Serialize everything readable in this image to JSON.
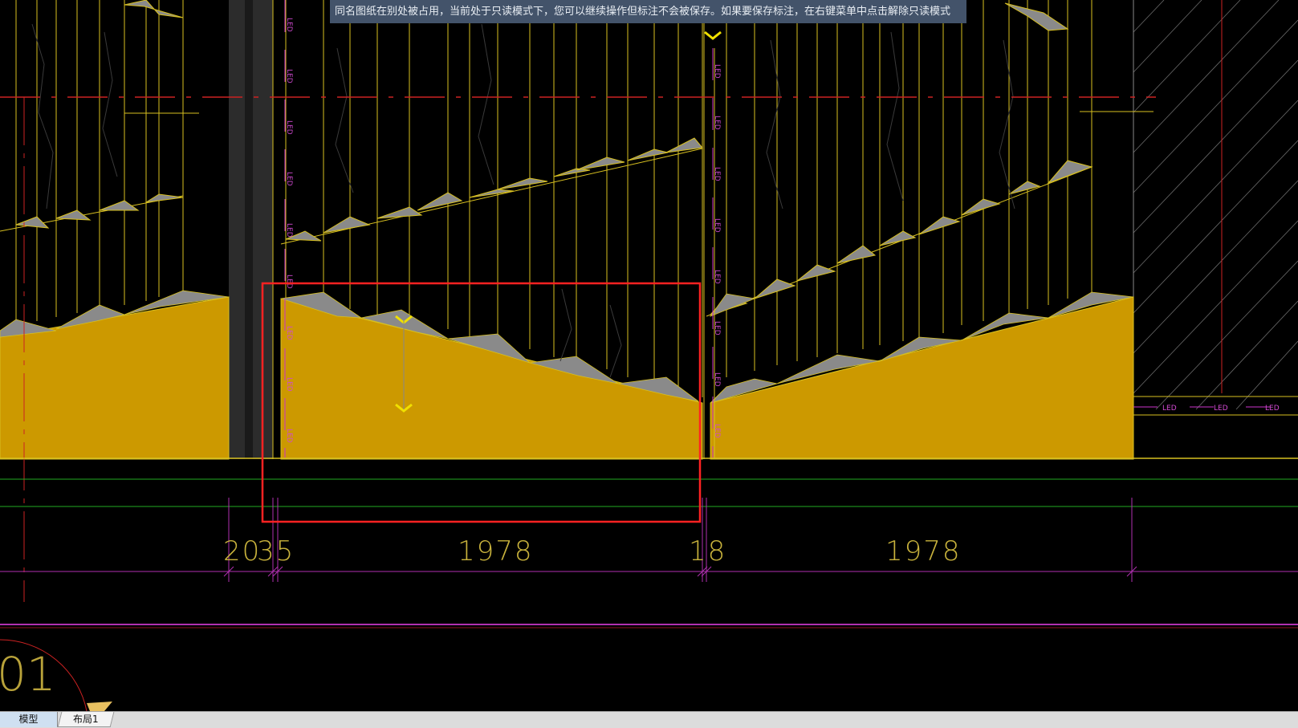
{
  "notice": {
    "text": "同名图纸在别处被占用，当前处于只读模式下，您可以继续操作但标注不会被保存。如果要保存标注，在右键菜单中点击解除只读模式"
  },
  "drawing": {
    "led_label": "LED",
    "dimensions": [
      "20",
      "35",
      "1978",
      "18",
      "1978"
    ],
    "corner_label": "01",
    "colors": {
      "background": "#000000",
      "fill": "#cc9900",
      "panel_line": "#d8c020",
      "led_line": "#cc33cc",
      "axis_line": "#cc2222",
      "highlight_box": "#ff2222",
      "dim_line": "#b030b0",
      "guide_line": "#22aa22"
    }
  },
  "tabs": {
    "model": "模型",
    "layout1": "布局1"
  }
}
